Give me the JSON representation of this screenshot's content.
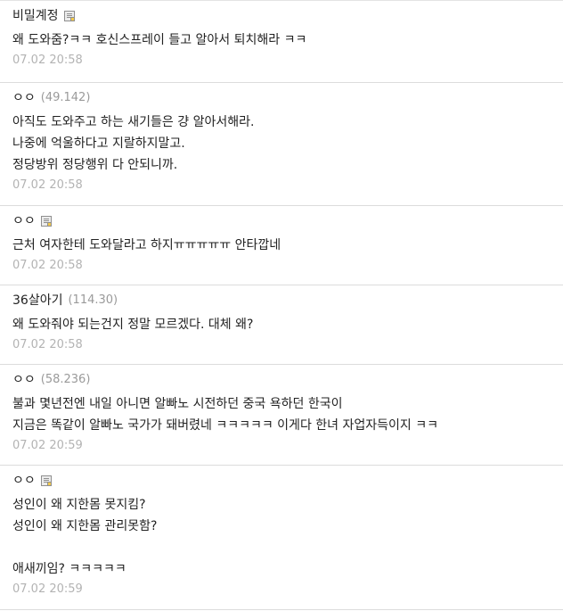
{
  "comments": [
    {
      "name": "비밀계정",
      "ip": "",
      "lines": [
        "왜 도와줌?ㅋㅋ 호신스프레이 들고 알아서 퇴치해라 ㅋㅋ"
      ],
      "date": "07.02 20:58"
    },
    {
      "name": "ㅇㅇ",
      "ip": "49.142",
      "lines": [
        "아직도 도와주고 하는 새기들은 걍 알아서해라.",
        "나중에 억울하다고 지랄하지말고.",
        "정당방위 정당행위 다 안되니까."
      ],
      "date": "07.02 20:58"
    },
    {
      "name": "ㅇㅇ",
      "ip": "",
      "lines": [
        "근처 여자한테 도와달라고 하지ㅠㅠㅠㅠㅠ 안타깝네"
      ],
      "date": "07.02 20:58"
    },
    {
      "name": "36살아기",
      "ip": "114.30",
      "lines": [
        "왜 도와줘야 되는건지 정말 모르겠다. 대체 왜?"
      ],
      "date": "07.02 20:58"
    },
    {
      "name": "ㅇㅇ",
      "ip": "58.236",
      "lines": [
        "불과 몇년전엔 내일 아니면 알빠노 시전하던 중국 욕하던 한국이",
        "지금은 똑같이 알빠노 국가가 돼버렸네 ㅋㅋㅋㅋㅋ 이게다 한녀 자업자득이지 ㅋㅋ"
      ],
      "date": "07.02 20:59"
    },
    {
      "name": "ㅇㅇ",
      "ip": "",
      "lines": [
        "성인이 왜 지한몸 못지킴?",
        "성인이 왜 지한몸 관리못함?",
        "",
        "애새끼임? ㅋㅋㅋㅋㅋ"
      ],
      "date": "07.02 20:59"
    }
  ]
}
